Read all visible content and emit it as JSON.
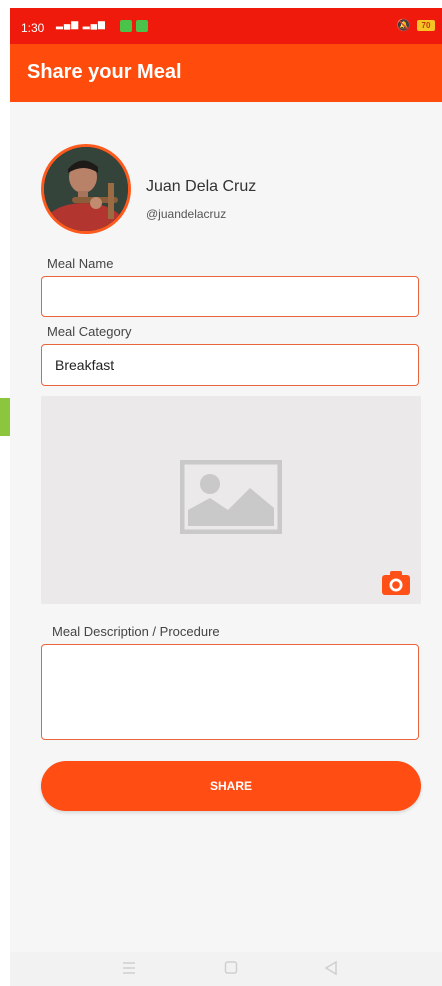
{
  "status_bar": {
    "time": "1:30",
    "battery": "70",
    "colors": {
      "background": "#ef1a0b"
    }
  },
  "app_bar": {
    "title": "Share your Meal",
    "color": "#ff4c0d"
  },
  "profile": {
    "name": "Juan Dela Cruz",
    "handle": "@juandelacruz"
  },
  "form": {
    "meal_name": {
      "label": "Meal Name",
      "value": ""
    },
    "meal_category": {
      "label": "Meal Category",
      "value": "Breakfast"
    },
    "image": {
      "placeholder_icon": "image-placeholder-icon",
      "action_icon": "camera-icon"
    },
    "description": {
      "label": "Meal Description / Procedure",
      "value": ""
    },
    "share_label": "SHARE"
  },
  "nav": {
    "icons": [
      "menu-icon",
      "home-square-icon",
      "back-triangle-icon"
    ]
  },
  "accent_color": "#ff4d14"
}
